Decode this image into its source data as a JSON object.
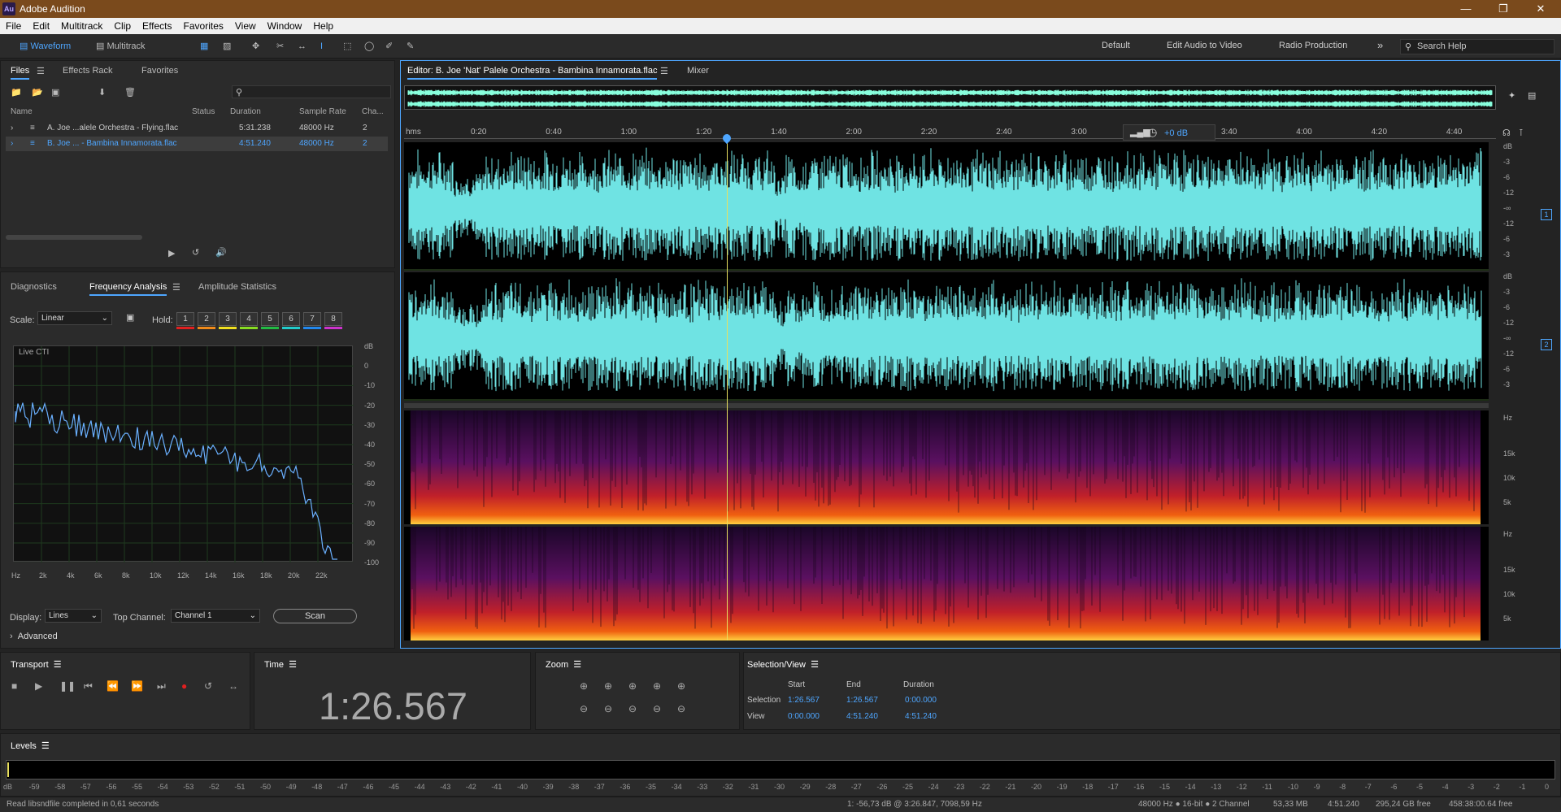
{
  "app": {
    "title": "Adobe Audition",
    "logo": "Au"
  },
  "menu": [
    "File",
    "Edit",
    "Multitrack",
    "Clip",
    "Effects",
    "Favorites",
    "View",
    "Window",
    "Help"
  ],
  "toolbar": {
    "waveform_label": "Waveform",
    "multitrack_label": "Multitrack",
    "workspaces": [
      "Default",
      "Edit Audio to Video",
      "Radio Production"
    ],
    "search_placeholder": "Search Help"
  },
  "files_panel": {
    "tabs": [
      "Files",
      "Effects Rack",
      "Favorites"
    ],
    "columns": [
      "Name",
      "Status",
      "Duration",
      "Sample Rate",
      "Cha..."
    ],
    "rows": [
      {
        "name": "A. Joe ...alele Orchestra - Flying.flac",
        "duration": "5:31.238",
        "rate": "48000 Hz",
        "channels": "2",
        "selected": false
      },
      {
        "name": "B. Joe ... - Bambina Innamorata.flac",
        "duration": "4:51.240",
        "rate": "48000 Hz",
        "channels": "2",
        "selected": true
      }
    ]
  },
  "analysis_panel": {
    "tabs": [
      "Diagnostics",
      "Frequency Analysis",
      "Amplitude Statistics"
    ],
    "scale_label": "Scale:",
    "scale_value": "Linear",
    "hold_label": "Hold:",
    "hold": [
      "1",
      "2",
      "3",
      "4",
      "5",
      "6",
      "7",
      "8"
    ],
    "hold_colors": [
      "#e02020",
      "#f08a1a",
      "#f0e020",
      "#88dd22",
      "#22bb44",
      "#22cccc",
      "#2288ee",
      "#cc33cc"
    ],
    "graph_caption": "Live CTI",
    "db_ticks": [
      "dB",
      "0",
      "-10",
      "-20",
      "-30",
      "-40",
      "-50",
      "-60",
      "-70",
      "-80",
      "-90",
      "-100"
    ],
    "freq_ticks": [
      "Hz",
      "2k",
      "4k",
      "6k",
      "8k",
      "10k",
      "12k",
      "14k",
      "16k",
      "18k",
      "20k",
      "22k"
    ],
    "display_label": "Display:",
    "display_value": "Lines",
    "top_channel_label": "Top Channel:",
    "top_channel_value": "Channel 1",
    "scan_label": "Scan",
    "advanced_label": "Advanced"
  },
  "editor": {
    "tab_title": "Editor: B. Joe 'Nat' Palele Orchestra - Bambina Innamorata.flac",
    "mixer_tab": "Mixer",
    "timeline_unit": "hms",
    "ticks": [
      "0:20",
      "0:40",
      "1:00",
      "1:20",
      "1:40",
      "2:00",
      "2:20",
      "2:40",
      "3:00",
      "3:20",
      "3:40",
      "4:00",
      "4:20",
      "4:40"
    ],
    "gain": "+0 dB",
    "db_scale": [
      "dB",
      "-3",
      "-6",
      "-12",
      "-∞",
      "-12",
      "-6",
      "-3"
    ],
    "channels": [
      "1",
      "2"
    ],
    "spec_scale": [
      "Hz",
      "15k",
      "10k",
      "5k"
    ],
    "playhead_fraction": 0.2977,
    "wave_color": "#6fe3e3"
  },
  "transport": {
    "title": "Transport"
  },
  "time": {
    "title": "Time",
    "value": "1:26.567"
  },
  "zoom": {
    "title": "Zoom"
  },
  "selection_view": {
    "title": "Selection/View",
    "headers": [
      "Start",
      "End",
      "Duration"
    ],
    "selection_label": "Selection",
    "view_label": "View",
    "selection": [
      "1:26.567",
      "1:26.567",
      "0:00.000"
    ],
    "view": [
      "0:00.000",
      "4:51.240",
      "4:51.240"
    ]
  },
  "levels": {
    "title": "Levels",
    "ticks": [
      "dB",
      "-59",
      "-58",
      "-57",
      "-56",
      "-55",
      "-54",
      "-53",
      "-52",
      "-51",
      "-50",
      "-49",
      "-48",
      "-47",
      "-46",
      "-45",
      "-44",
      "-43",
      "-42",
      "-41",
      "-40",
      "-39",
      "-38",
      "-37",
      "-36",
      "-35",
      "-34",
      "-33",
      "-32",
      "-31",
      "-30",
      "-29",
      "-28",
      "-27",
      "-26",
      "-25",
      "-24",
      "-23",
      "-22",
      "-21",
      "-20",
      "-19",
      "-18",
      "-17",
      "-16",
      "-15",
      "-14",
      "-13",
      "-12",
      "-11",
      "-10",
      "-9",
      "-8",
      "-7",
      "-6",
      "-5",
      "-4",
      "-3",
      "-2",
      "-1",
      "0"
    ]
  },
  "status": {
    "left": "Read libsndfile completed in 0,61 seconds",
    "cursor": "1: -56,73 dB @ 3:26.847, 7098,59 Hz",
    "format": "48000 Hz ● 16-bit ● 2 Channel",
    "size": "53,33 MB",
    "duration": "4:51.240",
    "free": "295,24 GB free",
    "free_time": "458:38:00.64 free"
  }
}
